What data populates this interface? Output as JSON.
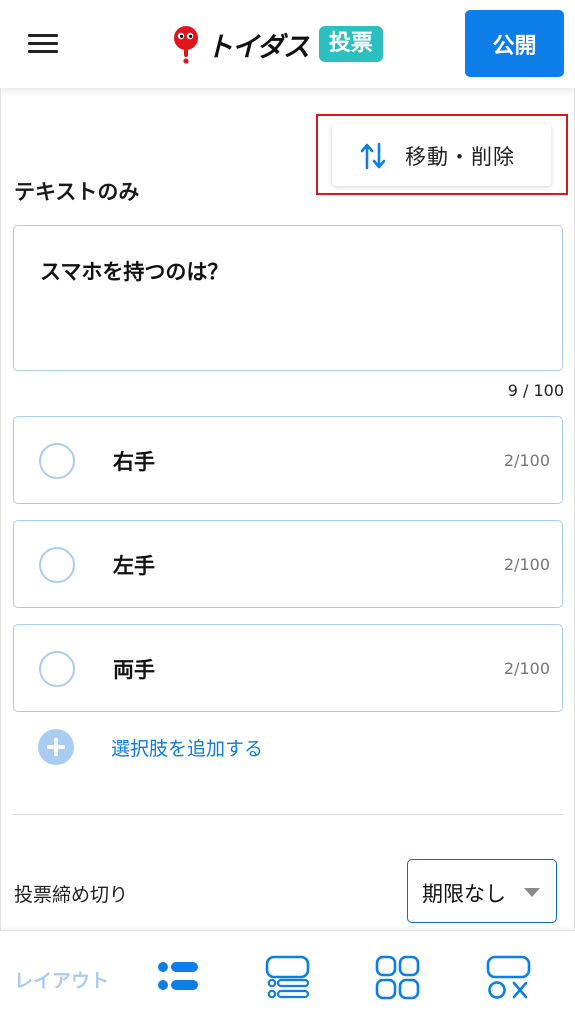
{
  "header": {
    "logo_text": "トイダス",
    "logo_badge": "投票",
    "publish_label": "公開"
  },
  "toolbar": {
    "move_delete_label": "移動・削除"
  },
  "section": {
    "title": "テキストのみ"
  },
  "question": {
    "text": "スマホを持つのは？",
    "counter": "9 / 100"
  },
  "options": [
    {
      "label": "右手",
      "count": "2/100"
    },
    {
      "label": "左手",
      "count": "2/100"
    },
    {
      "label": "両手",
      "count": "2/100"
    }
  ],
  "add_option": {
    "label": "選択肢を追加する"
  },
  "deadline": {
    "label": "投票締め切り",
    "value": "期限なし"
  },
  "bottom_bar": {
    "layout_label": "レイアウト",
    "icons": [
      "list-layout-icon",
      "stacked-layout-icon",
      "grid-layout-icon",
      "mixed-layout-icon"
    ]
  },
  "colors": {
    "primary": "#0d7de8",
    "outline": "#a9cdf2",
    "badge": "#2bbfbf",
    "highlight_box": "#e0141b",
    "logo_red": "#e0141b"
  }
}
